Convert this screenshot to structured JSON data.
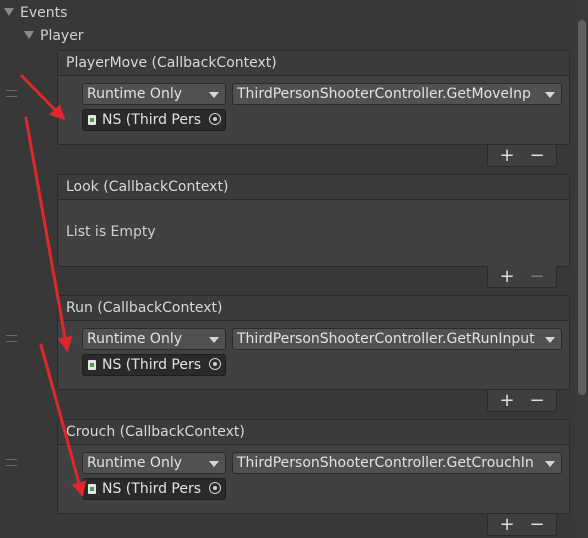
{
  "tree": {
    "events_label": "Events",
    "player_label": "Player"
  },
  "events": [
    {
      "header": "PlayerMove (CallbackContext)",
      "runtime": "Runtime Only",
      "function": "ThirdPersonShooterController.GetMoveInp",
      "object": "NS (Third Pers",
      "add": "+",
      "remove": "−"
    },
    {
      "header": "Look (CallbackContext)",
      "empty": "List is Empty",
      "add": "+",
      "remove": "−"
    },
    {
      "header": "Run (CallbackContext)",
      "runtime": "Runtime Only",
      "function": "ThirdPersonShooterController.GetRunInput",
      "object": "NS (Third Pers",
      "add": "+",
      "remove": "−"
    },
    {
      "header": "Crouch (CallbackContext)",
      "runtime": "Runtime Only",
      "function": "ThirdPersonShooterController.GetCrouchIn",
      "object": "NS (Third Pers",
      "add": "+",
      "remove": "−"
    }
  ],
  "colors": {
    "background": "#383838",
    "panel": "#414141",
    "annotation_arrow": "#e0282c"
  }
}
